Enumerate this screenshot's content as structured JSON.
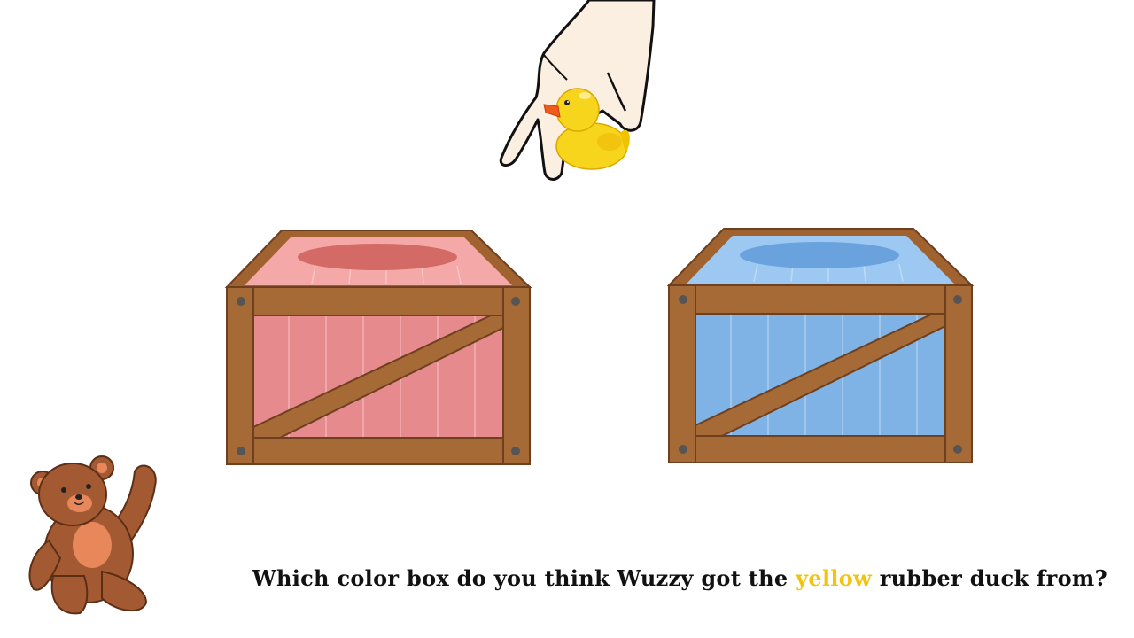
{
  "question": {
    "prefix": "Which color box do you think Wuzzy got the ",
    "highlight": "yellow",
    "suffix": " rubber duck from?",
    "highlight_color": "#F2C40F"
  },
  "boxes": [
    {
      "name": "red-box",
      "color": "#E68A8E",
      "lid_color": "#F4A8A8",
      "spot_color": "#D46A66"
    },
    {
      "name": "blue-box",
      "color": "#7FB3E6",
      "lid_color": "#9CC8F2",
      "spot_color": "#6AA2DE"
    }
  ],
  "colors": {
    "wood": "#A0622F",
    "wood_dark": "#7A4A24",
    "duck": "#F7D51C",
    "duck_beak": "#F25A1B",
    "bear": "#A35A33",
    "bear_light": "#E8875A"
  }
}
